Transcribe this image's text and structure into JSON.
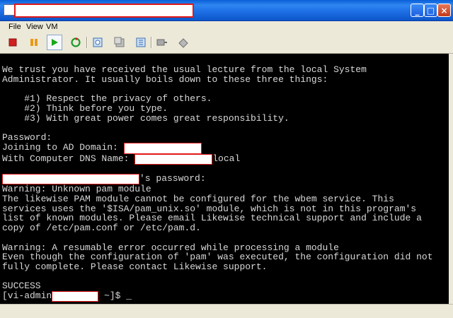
{
  "window": {
    "title": "",
    "buttons": {
      "minimize": "_",
      "maximize": "□",
      "close": "×"
    }
  },
  "menu": {
    "items": [
      "File",
      "View",
      "VM"
    ]
  },
  "toolbar": {
    "icons": [
      "power-off-icon",
      "pause-icon",
      "play-icon",
      "reset-icon",
      "snapshot-icon",
      "revert-snapshot-icon",
      "snapshot-manager-icon",
      "removable-devices-icon",
      "settings-icon"
    ],
    "colors": {
      "power_off": "#d02020",
      "pause": "#e89a1a",
      "play": "#18a818",
      "reset": "#1a9a2a"
    }
  },
  "console": {
    "lines": [
      "We trust you have received the usual lecture from the local System",
      "Administrator. It usually boils down to these three things:",
      "",
      "    #1) Respect the privacy of others.",
      "    #2) Think before you type.",
      "    #3) With great power comes great responsibility.",
      "",
      "Password:",
      "Joining to AD Domain: ",
      "With Computer DNS Name: ",
      "",
      "",
      "Warning: Unknown pam module",
      "The likewise PAM module cannot be configured for the wbem service. This",
      "services uses the '$ISA/pam_unix.so' module, which is not in this program's",
      "list of known modules. Please email Likewise technical support and include a",
      "copy of /etc/pam.conf or /etc/pam.d.",
      "",
      "Warning: A resumable error occurred while processing a module",
      "Even though the configuration of 'pam' was executed, the configuration did not",
      "fully complete. Please contact Likewise support.",
      "",
      "SUCCESS",
      "[vi-admin"
    ],
    "dns_suffix": "local",
    "password_prompt_suffix": "'s password:",
    "prompt_suffix": " ~]$ _"
  }
}
